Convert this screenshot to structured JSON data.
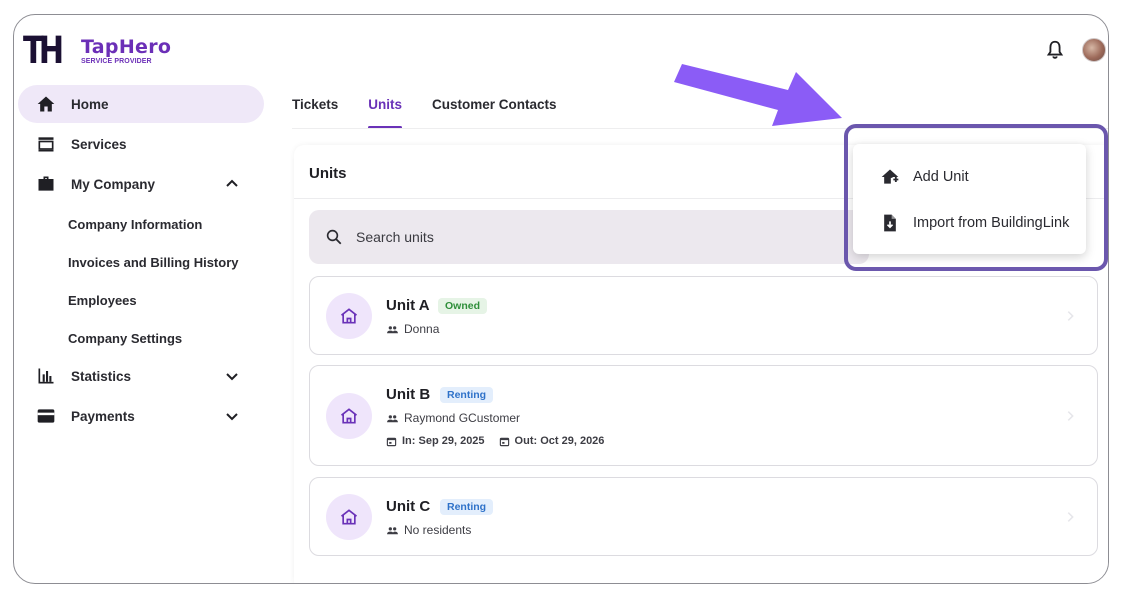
{
  "brand": {
    "mark": "TH",
    "name": "TapHero",
    "subtitle": "SERVICE PROVIDER"
  },
  "colors": {
    "accent": "#6a32b8",
    "highlight_border": "#6b57ad",
    "arrow": "#8b5cf6",
    "owned": "#2f8f3a",
    "renting": "#2f72c9"
  },
  "sidebar": {
    "items": [
      {
        "label": "Home",
        "icon": "home-icon",
        "active": true
      },
      {
        "label": "Services",
        "icon": "services-icon"
      },
      {
        "label": "My Company",
        "icon": "briefcase-icon",
        "expanded": true
      },
      {
        "label": "Statistics",
        "icon": "bar-chart-icon",
        "expanded": false
      },
      {
        "label": "Payments",
        "icon": "credit-card-icon",
        "expanded": false
      }
    ],
    "company_subitems": [
      "Company Information",
      "Invoices and Billing History",
      "Employees",
      "Company Settings"
    ]
  },
  "header": {
    "icons": [
      "bell-icon",
      "avatar"
    ]
  },
  "tabs": [
    {
      "label": "Tickets",
      "active": false
    },
    {
      "label": "Units",
      "active": true
    },
    {
      "label": "Customer Contacts",
      "active": false
    }
  ],
  "panel": {
    "title": "Units",
    "search_placeholder": "Search units",
    "units": [
      {
        "name": "Unit A",
        "status": "Owned",
        "residents": "Donna"
      },
      {
        "name": "Unit B",
        "status": "Renting",
        "residents": "Raymond GCustomer",
        "in": "In: Sep 29, 2025",
        "out": "Out: Oct 29, 2026"
      },
      {
        "name": "Unit C",
        "status": "Renting",
        "residents": "No residents"
      }
    ]
  },
  "menu": {
    "items": [
      {
        "label": "Add Unit",
        "icon": "add-home-icon"
      },
      {
        "label": "Import from BuildingLink",
        "icon": "file-import-icon"
      }
    ]
  }
}
